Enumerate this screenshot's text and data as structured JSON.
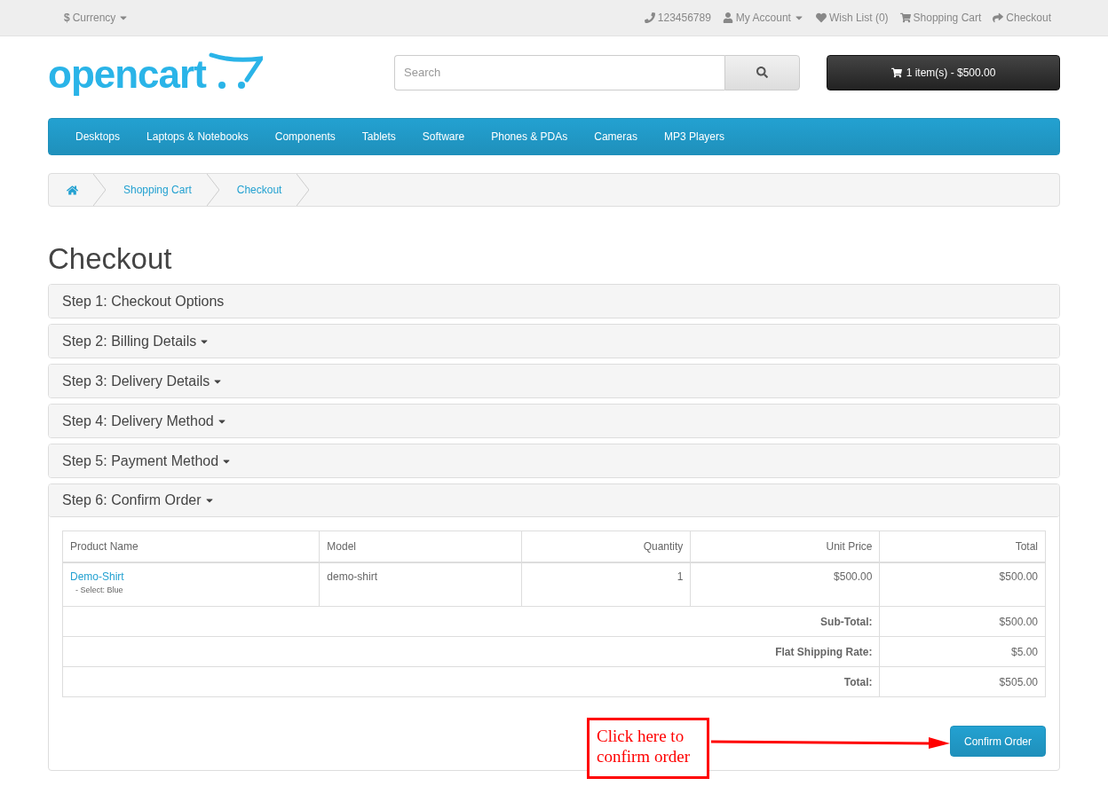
{
  "top_bar": {
    "currency": {
      "symbol": "$",
      "label": "Currency"
    },
    "links": [
      {
        "kind": "phone",
        "label": "123456789",
        "dropdown": false
      },
      {
        "kind": "user",
        "label": "My Account",
        "dropdown": true
      },
      {
        "kind": "heart",
        "label": "Wish List (0)",
        "dropdown": false
      },
      {
        "kind": "cart",
        "label": "Shopping Cart",
        "dropdown": false
      },
      {
        "kind": "share",
        "label": "Checkout",
        "dropdown": false
      }
    ]
  },
  "header": {
    "logo": "opencart",
    "search": {
      "placeholder": "Search"
    },
    "cart_button": "1 item(s) - $500.00"
  },
  "menu": [
    "Desktops",
    "Laptops & Notebooks",
    "Components",
    "Tablets",
    "Software",
    "Phones & PDAs",
    "Cameras",
    "MP3 Players"
  ],
  "breadcrumb": [
    "Shopping Cart",
    "Checkout"
  ],
  "title": "Checkout",
  "steps": [
    {
      "title": "Step 1: Checkout Options",
      "dropdown": false,
      "expanded": false
    },
    {
      "title": "Step 2: Billing Details",
      "dropdown": true,
      "expanded": false
    },
    {
      "title": "Step 3: Delivery Details",
      "dropdown": true,
      "expanded": false
    },
    {
      "title": "Step 4: Delivery Method",
      "dropdown": true,
      "expanded": false
    },
    {
      "title": "Step 5: Payment Method",
      "dropdown": true,
      "expanded": false
    },
    {
      "title": "Step 6: Confirm Order",
      "dropdown": true,
      "expanded": true
    }
  ],
  "order_table": {
    "columns": [
      "Product Name",
      "Model",
      "Quantity",
      "Unit Price",
      "Total"
    ],
    "rows": [
      {
        "product": "Demo-Shirt",
        "option": "- Select: Blue",
        "model": "demo-shirt",
        "quantity": "1",
        "unit_price": "$500.00",
        "total": "$500.00"
      }
    ],
    "totals": [
      {
        "label": "Sub-Total:",
        "value": "$500.00"
      },
      {
        "label": "Flat Shipping Rate:",
        "value": "$5.00"
      },
      {
        "label": "Total:",
        "value": "$505.00"
      }
    ]
  },
  "confirm_button": "Confirm Order",
  "annotation": {
    "text": "Click here to confirm order"
  }
}
